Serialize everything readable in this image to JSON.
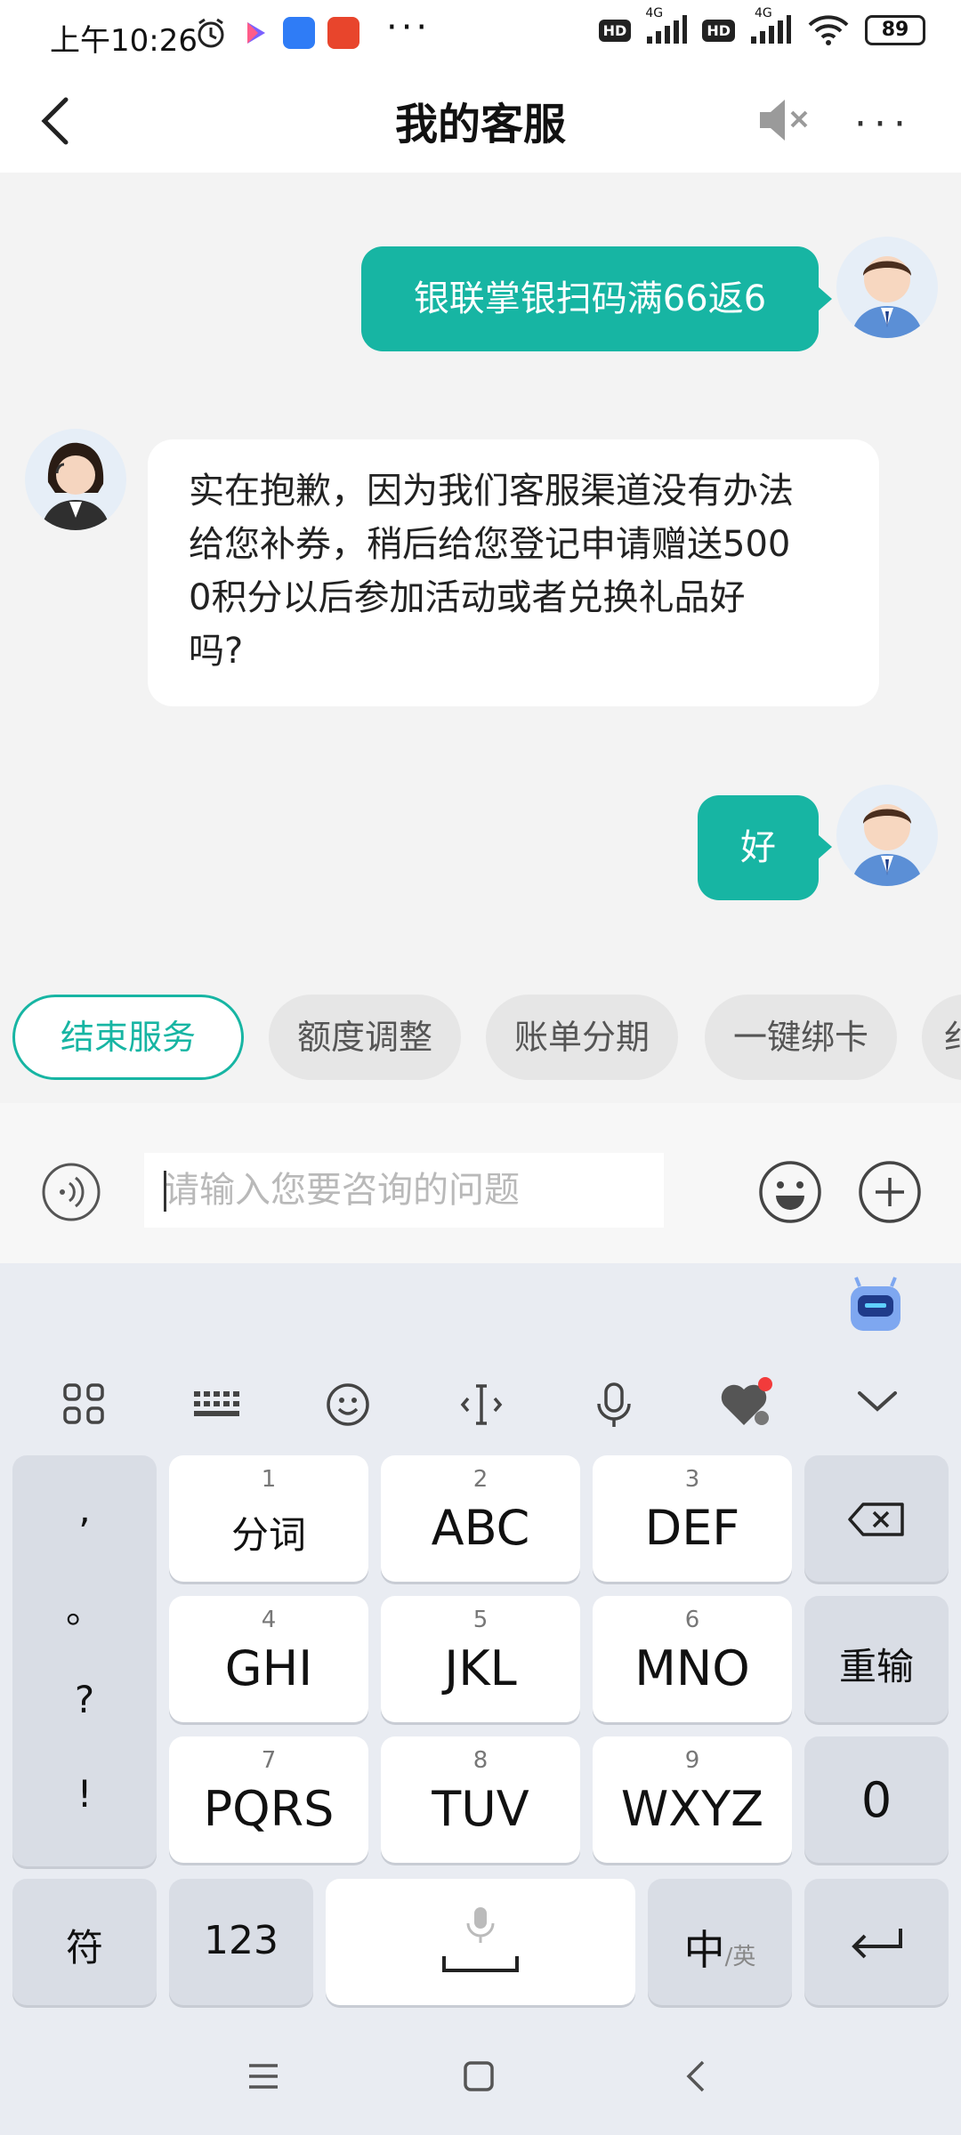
{
  "status_bar": {
    "time": "上午10:26",
    "hd1": "HD",
    "hd2": "HD",
    "net1": "4G",
    "net2": "4G",
    "battery": "89"
  },
  "header": {
    "title": "我的客服"
  },
  "chat": {
    "messages": [
      {
        "from": "user",
        "text": "银联掌银扫码满66返6"
      },
      {
        "from": "agent",
        "lines": [
          "实在抱歉，因为我们客服渠道没有办法",
          "给您补券，稍后给您登记申请赠送500",
          "0积分以后参加活动或者兑换礼品好",
          "吗?"
        ]
      },
      {
        "from": "user",
        "text": "好"
      }
    ]
  },
  "quick_actions": [
    "结束服务",
    "额度调整",
    "账单分期",
    "一键绑卡",
    "纟"
  ],
  "input": {
    "placeholder": "请输入您要咨询的问题"
  },
  "keyboard": {
    "punct": [
      ",",
      "。",
      "?",
      "!"
    ],
    "rows": [
      [
        {
          "num": "1",
          "label": "分词"
        },
        {
          "num": "2",
          "label": "ABC"
        },
        {
          "num": "3",
          "label": "DEF"
        }
      ],
      [
        {
          "num": "4",
          "label": "GHI"
        },
        {
          "num": "5",
          "label": "JKL"
        },
        {
          "num": "6",
          "label": "MNO"
        }
      ],
      [
        {
          "num": "7",
          "label": "PQRS"
        },
        {
          "num": "8",
          "label": "TUV"
        },
        {
          "num": "9",
          "label": "WXYZ"
        }
      ]
    ],
    "reenter": "重输",
    "zero": "0",
    "symbols": "符",
    "num_mode": "123",
    "lang_main": "中",
    "lang_alt": "/英"
  },
  "colors": {
    "accent": "#17b5a3",
    "background": "#f3f3f3",
    "keyboard_bg": "#e9ecf2"
  }
}
